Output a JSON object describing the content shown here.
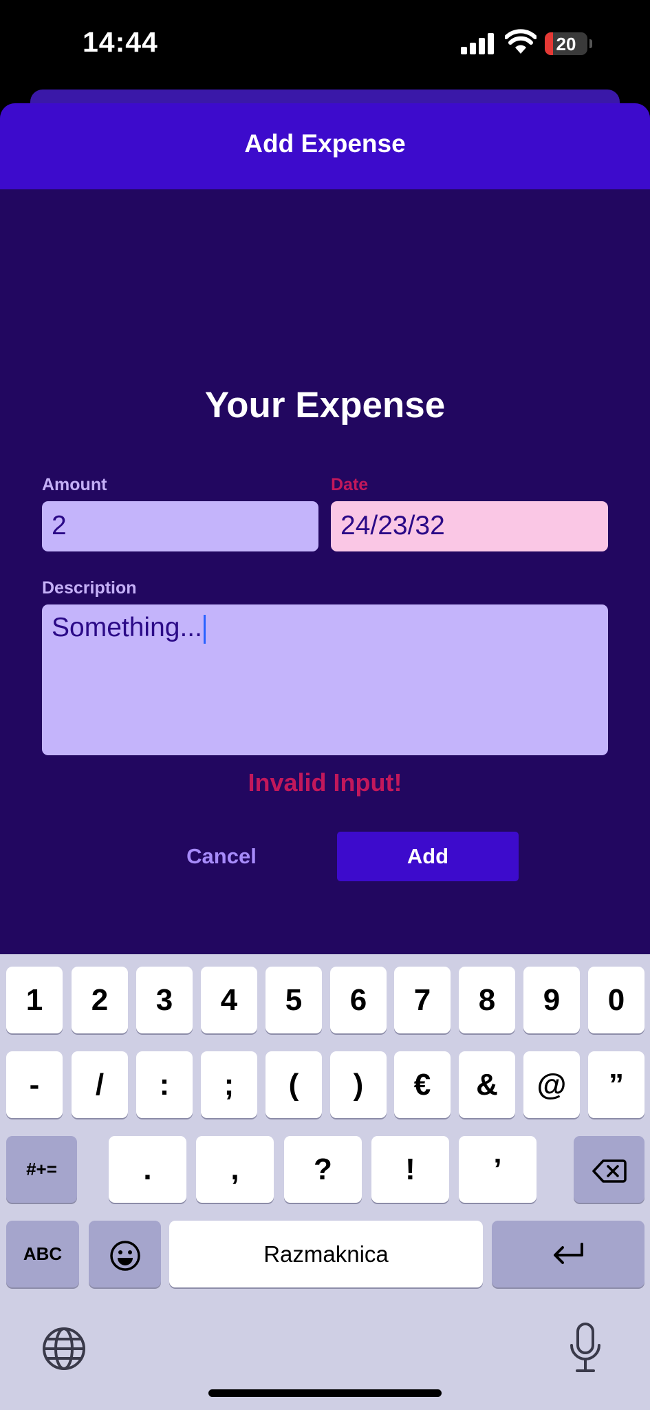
{
  "status": {
    "time": "14:44",
    "battery": "20"
  },
  "nav": {
    "title": "Add Expense"
  },
  "form": {
    "heading": "Your Expense",
    "amount_label": "Amount",
    "amount_value": "2",
    "date_label": "Date",
    "date_value": "24/23/32",
    "description_label": "Description",
    "description_value": "Something...",
    "error": "Invalid Input!",
    "cancel_label": "Cancel",
    "add_label": "Add"
  },
  "keyboard": {
    "row1": [
      "1",
      "2",
      "3",
      "4",
      "5",
      "6",
      "7",
      "8",
      "9",
      "0"
    ],
    "row2": [
      "-",
      "/",
      ":",
      ";",
      "(",
      ")",
      "€",
      "&",
      "@",
      "”"
    ],
    "row3": [
      ".",
      ",",
      "?",
      "!",
      "’"
    ],
    "symbols_label": "#+=",
    "abc_label": "ABC",
    "space_label": "Razmaknica"
  },
  "colors": {
    "nav": "#3d0bcc",
    "background": "#220760",
    "field": "#c4b4fb",
    "error_field": "#fac7e5",
    "error_text": "#c2185b"
  }
}
